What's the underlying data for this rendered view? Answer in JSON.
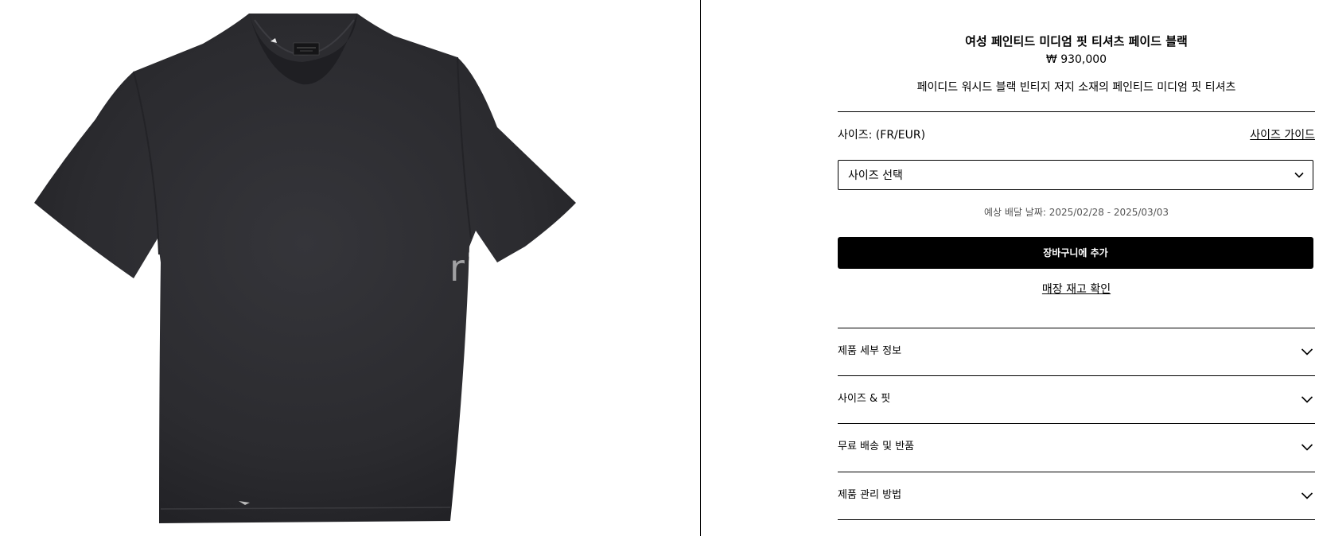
{
  "product": {
    "title": "여성 페인티드 미디엄 핏 티셔츠 페이드 블랙",
    "price": "₩ 930,000",
    "description": "페이디드 워시드 블랙 빈티지 저지 소재의 페인티드 미디엄 핏 티셔츠"
  },
  "size": {
    "label": "사이즈: (FR/EUR)",
    "guide_link": "사이즈 가이드",
    "select_placeholder": "사이즈 선택"
  },
  "delivery_text": "예상 배달 날짜: 2025/02/28 - 2025/03/03",
  "actions": {
    "add_to_cart": "장바구니에 추가",
    "check_store_stock": "매장 재고 확인"
  },
  "accordion": [
    {
      "label": "제품 세부 정보"
    },
    {
      "label": "사이즈 & 핏"
    },
    {
      "label": "무료 배송 및 반품"
    },
    {
      "label": "제품 관리 방법"
    }
  ],
  "image": {
    "watermark": "rix"
  },
  "colors": {
    "shirt": "#2b2b2e",
    "button_bg": "#000000",
    "button_text": "#ffffff"
  }
}
